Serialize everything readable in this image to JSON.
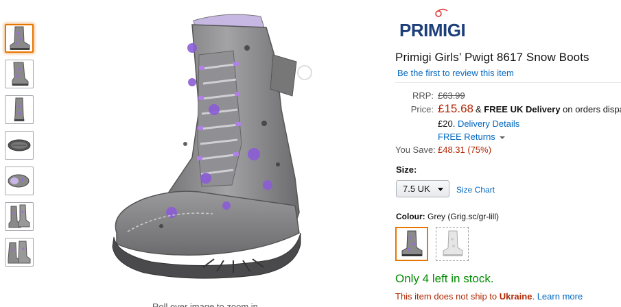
{
  "thumbnails": [
    {
      "view": "side-front",
      "selected": true
    },
    {
      "view": "side-back",
      "selected": false
    },
    {
      "view": "front",
      "selected": false
    },
    {
      "view": "sole",
      "selected": false
    },
    {
      "view": "top",
      "selected": false
    },
    {
      "view": "pair",
      "selected": false
    },
    {
      "view": "pair-alt",
      "selected": false
    }
  ],
  "main_image": {
    "icon": "snow-boot-image"
  },
  "rollover_text": "Roll over image to zoom in",
  "brand": {
    "name": "PRIMIGI",
    "logo_color": "#1c3f7a"
  },
  "product": {
    "title": "Primigi Girls’ Pwigt 8617 Snow Boots",
    "review_link": "Be the first to review this item"
  },
  "pricing": {
    "rrp_label": "RRP:",
    "rrp_value": "£63.99",
    "price_label": "Price:",
    "price_value": "£15.68",
    "amp": "&",
    "free_delivery": "FREE UK Delivery",
    "delivery_tail": " on orders dispa",
    "threshold": "£20.",
    "delivery_details": "Delivery Details",
    "free_returns": "FREE Returns",
    "save_label": "You Save:",
    "save_value": "£48.31 (75%)"
  },
  "size": {
    "label": "Size:",
    "selected": "7.5 UK",
    "size_chart": "Size Chart"
  },
  "colour": {
    "label": "Colour:",
    "value": "Grey (Grig.sc/gr-lill)",
    "swatches": [
      "grey-lilac",
      "grey-white"
    ]
  },
  "stock": "Only 4 left in stock.",
  "shipping": {
    "prefix": "This item does not ship to ",
    "country": "Ukraine",
    "suffix": ".",
    "learn_more": "Learn more"
  },
  "colors": {
    "accent": "#e77600",
    "link": "#0066c0",
    "price": "#b12704",
    "in_stock": "#008a00"
  }
}
